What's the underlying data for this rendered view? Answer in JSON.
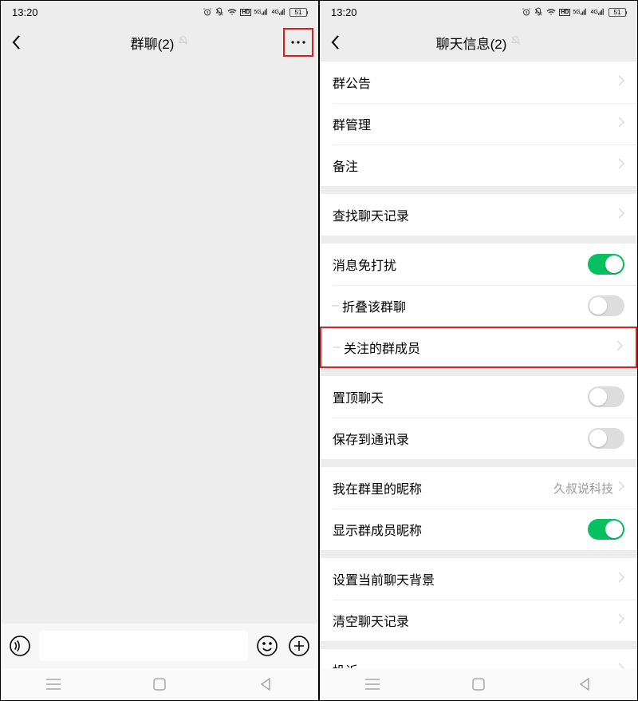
{
  "status": {
    "time": "13:20",
    "battery": "51"
  },
  "left": {
    "title": "群聊(2)",
    "input_placeholder": ""
  },
  "right": {
    "title": "聊天信息(2)",
    "groups": [
      {
        "rows": [
          {
            "label": "群公告",
            "type": "chevron"
          },
          {
            "label": "群管理",
            "type": "chevron"
          },
          {
            "label": "备注",
            "type": "chevron"
          }
        ]
      },
      {
        "rows": [
          {
            "label": "查找聊天记录",
            "type": "chevron"
          }
        ]
      },
      {
        "rows": [
          {
            "label": "消息免打扰",
            "type": "toggle",
            "on": true
          },
          {
            "label": "折叠该群聊",
            "type": "toggle",
            "on": false,
            "sub": true
          },
          {
            "label": "关注的群成员",
            "type": "chevron",
            "sub": true,
            "highlight": true
          }
        ]
      },
      {
        "rows": [
          {
            "label": "置顶聊天",
            "type": "toggle",
            "on": false
          },
          {
            "label": "保存到通讯录",
            "type": "toggle",
            "on": false
          }
        ]
      },
      {
        "rows": [
          {
            "label": "我在群里的昵称",
            "type": "value",
            "value": "久叔说科技"
          },
          {
            "label": "显示群成员昵称",
            "type": "toggle",
            "on": true
          }
        ]
      },
      {
        "rows": [
          {
            "label": "设置当前聊天背景",
            "type": "chevron"
          },
          {
            "label": "清空聊天记录",
            "type": "chevron"
          }
        ]
      },
      {
        "rows": [
          {
            "label": "投诉",
            "type": "chevron"
          }
        ]
      }
    ]
  }
}
